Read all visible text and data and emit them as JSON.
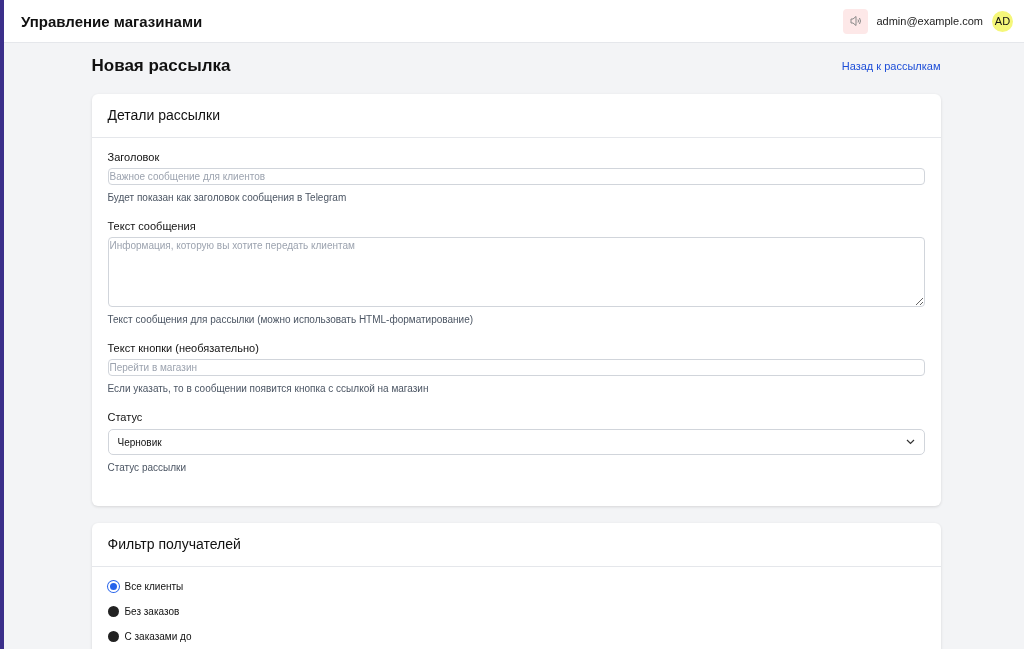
{
  "header": {
    "title": "Управление магазинами",
    "user_email": "admin@example.com",
    "avatar_initials": "AD"
  },
  "page": {
    "title": "Новая рассылка",
    "back_link": "Назад к рассылкам"
  },
  "details_card": {
    "title": "Детали рассылки",
    "fields": [
      {
        "kind": "input",
        "label": "Заголовок",
        "placeholder": "Важное сообщение для клиентов",
        "help": "Будет показан как заголовок сообщения в Telegram"
      },
      {
        "kind": "textarea",
        "label": "Текст сообщения",
        "placeholder": "Информация, которую вы хотите передать клиентам",
        "help": "Текст сообщения для рассылки (можно использовать HTML-форматирование)"
      },
      {
        "kind": "input",
        "label": "Текст кнопки (необязательно)",
        "placeholder": "Перейти в магазин",
        "help": "Если указать, то в сообщении появится кнопка с ссылкой на магазин"
      },
      {
        "kind": "select",
        "label": "Статус",
        "value": "Черновик",
        "help": "Статус рассылки"
      }
    ]
  },
  "filter_card": {
    "title": "Фильтр получателей",
    "options": [
      {
        "label": "Все клиенты",
        "selected": true
      },
      {
        "label": "Без заказов",
        "selected": false
      },
      {
        "label": "С заказами до",
        "selected": false
      }
    ]
  }
}
